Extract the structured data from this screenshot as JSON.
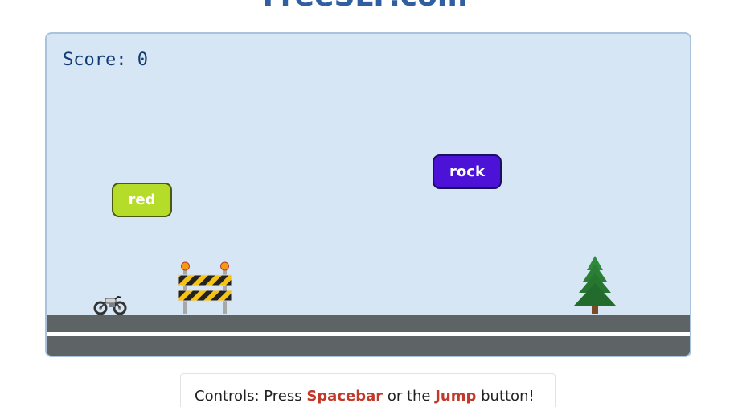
{
  "site": {
    "title": "FreeSLP.com"
  },
  "game": {
    "score_label": "Score:",
    "score_value": "0",
    "words": [
      {
        "text": "red",
        "color": "#b6dc2a"
      },
      {
        "text": "rock",
        "color": "#4d12d8"
      }
    ],
    "objects": [
      "motorcycle-icon",
      "road-barrier-icon",
      "pine-tree-icon"
    ]
  },
  "controls": {
    "prefix": "Controls: Press ",
    "key_label": "Spacebar",
    "middle": " or the ",
    "button_label": "Jump",
    "suffix": " button!",
    "accent_colors": {
      "spacebar": "#c0392b",
      "jump": "#c0392b"
    }
  }
}
